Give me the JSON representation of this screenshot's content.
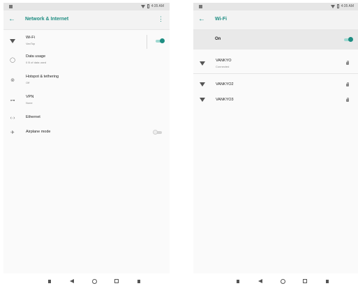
{
  "status_bar": {
    "time": "4:35 AM"
  },
  "network_screen": {
    "title": "Network & Internet",
    "items": [
      {
        "title": "Wi-Fi",
        "subtitle": "VanTop",
        "icon": "wifi-icon",
        "toggle": true
      },
      {
        "title": "Data usage",
        "subtitle": "0 B of data used",
        "icon": "data-usage-icon"
      },
      {
        "title": "Hotspot & tethering",
        "subtitle": "Off",
        "icon": "hotspot-icon"
      },
      {
        "title": "VPN",
        "subtitle": "None",
        "icon": "vpn-key-icon"
      },
      {
        "title": "Ethernet",
        "subtitle": "",
        "icon": "ethernet-icon"
      },
      {
        "title": "Airplane mode",
        "subtitle": "",
        "icon": "airplane-icon",
        "toggle": false
      }
    ]
  },
  "wifi_screen": {
    "title": "Wi-Fi",
    "master_label": "On",
    "master_on": true,
    "networks": [
      {
        "name": "VANKYO",
        "status": "Connected",
        "secured": true
      },
      {
        "name": "VANKYO2",
        "status": "",
        "secured": true
      },
      {
        "name": "VANKYO3",
        "status": "",
        "secured": true
      }
    ]
  },
  "colors": {
    "accent": "#1e8d82",
    "toggle_track_on": "#9fd8d1",
    "app_bar": "#f3f3f3"
  }
}
